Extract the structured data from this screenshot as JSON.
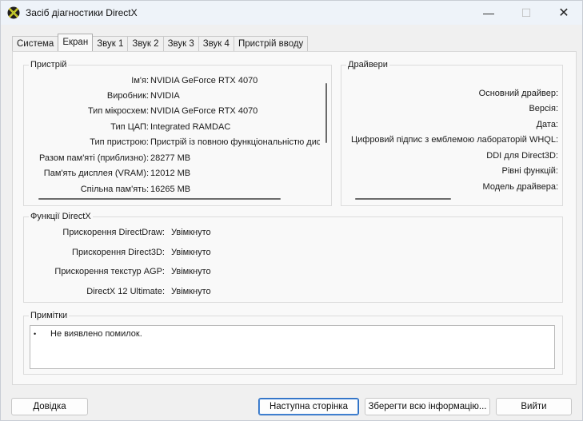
{
  "window": {
    "title": "Засіб діагностики DirectX",
    "minimize_glyph": "—",
    "maximize_glyph": "☐",
    "close_glyph": "✕"
  },
  "tabs": [
    {
      "label": "Система",
      "active": false
    },
    {
      "label": "Екран",
      "active": true
    },
    {
      "label": "Звук 1",
      "active": false
    },
    {
      "label": "Звук 2",
      "active": false
    },
    {
      "label": "Звук 3",
      "active": false
    },
    {
      "label": "Звук 4",
      "active": false
    },
    {
      "label": "Пристрій вводу",
      "active": false
    }
  ],
  "device": {
    "title": "Пристрій",
    "rows": [
      {
        "label": "Ім'я:",
        "value": "NVIDIA GeForce RTX 4070"
      },
      {
        "label": "Виробник:",
        "value": "NVIDIA"
      },
      {
        "label": "Тип мікросхем:",
        "value": "NVIDIA GeForce RTX 4070"
      },
      {
        "label": "Тип ЦАП:",
        "value": "Integrated RAMDAC"
      },
      {
        "label": "Тип пристрою:",
        "value": "Пристрій із повною функціональністю дис"
      },
      {
        "label": "Разом пам'яті (приблизно):",
        "value": "28277 MB"
      },
      {
        "label": "Пам'ять дисплея (VRAM):",
        "value": "12012 MB"
      },
      {
        "label": "Спільна пам'ять:",
        "value": "16265 MB"
      }
    ]
  },
  "drivers": {
    "title": "Драйвери",
    "rows": [
      {
        "label": "Основний драйвер:"
      },
      {
        "label": "Версія:"
      },
      {
        "label": "Дата:"
      },
      {
        "label": "Цифровий підпис з емблемою лабораторій WHQL:"
      },
      {
        "label": "DDI для Direct3D:"
      },
      {
        "label": "Рівні функцій:"
      },
      {
        "label": "Модель драйвера:"
      }
    ]
  },
  "directx_features": {
    "title": "Функції DirectX",
    "rows": [
      {
        "label": "Прискорення DirectDraw:",
        "value": "Увімкнуто"
      },
      {
        "label": "Прискорення Direct3D:",
        "value": "Увімкнуто"
      },
      {
        "label": "Прискорення текстур AGP:",
        "value": "Увімкнуто"
      },
      {
        "label": "DirectX 12 Ultimate:",
        "value": "Увімкнуто"
      }
    ]
  },
  "notes": {
    "title": "Примітки",
    "bullet": "•",
    "items": [
      "Не виявлено помилок."
    ]
  },
  "buttons": {
    "help": "Довідка",
    "next_page": "Наступна сторінка",
    "save_all": "Зберегти всю інформацію...",
    "exit": "Вийти"
  }
}
